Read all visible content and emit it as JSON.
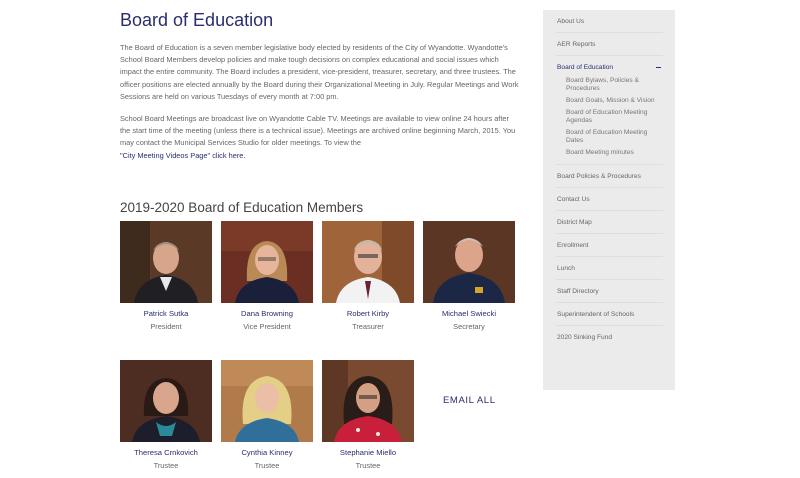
{
  "page": {
    "title": "Board of Education",
    "para1": "The Board of Education is a seven member legislative body elected by residents of the City of Wyandotte. Wyandotte's School Board Members develop policies and make tough decisions on complex educational and social issues which impact the entire community. The Board includes a president, vice-president, treasurer, secretary, and three trustees. The officer positions are elected annually by the Board during their Organizational Meeting in July. Regular Meetings and Work Sessions are held on various Tuesdays of every month at 7:00 pm.",
    "para2": "School Board Meetings are broadcast live on Wyandotte Cable TV. Meetings are available to view online 24 hours after the start time of the meeting (unless there is a technical issue). Meetings are archived online beginning March, 2015. You may contact the Municipal Services Studio for older meetings.  To view the",
    "para2_link": "\"City Meeting Videos Page\" click here.",
    "members_heading": "2019-2020 Board of Education Members",
    "email_all": "EMAIL ALL"
  },
  "members": [
    {
      "name": "Patrick Sutka",
      "role": "President"
    },
    {
      "name": "Dana Browning",
      "role": "Vice President"
    },
    {
      "name": "Robert Kirby",
      "role": "Treasurer"
    },
    {
      "name": "Michael Swiecki",
      "role": "Secretary"
    },
    {
      "name": "Theresa Crnkovich",
      "role": "Trustee"
    },
    {
      "name": "Cynthia Kinney",
      "role": "Trustee"
    },
    {
      "name": "Stephanie Miello",
      "role": "Trustee"
    }
  ],
  "sidebar": {
    "items_top": [
      "About Us",
      "AER Reports"
    ],
    "active": "Board of Education",
    "sub_items": [
      "Board Bylaws, Policies & Procedures",
      "Board Goals, Mission & Vision",
      "Board of Education Meeting Agendas",
      "Board of Education Meeting Dates",
      "Board Meeting minutes"
    ],
    "items_bottom": [
      "Board Policies & Procedures",
      "Contact Us",
      "District Map",
      "Enrollment",
      "Lunch",
      "Staff Directory",
      "Superintendent of Schools",
      "2020 Sinking Fund"
    ]
  },
  "colors": {
    "accent": "#2a2d6e",
    "sidebar_bg": "#ebebeb"
  }
}
